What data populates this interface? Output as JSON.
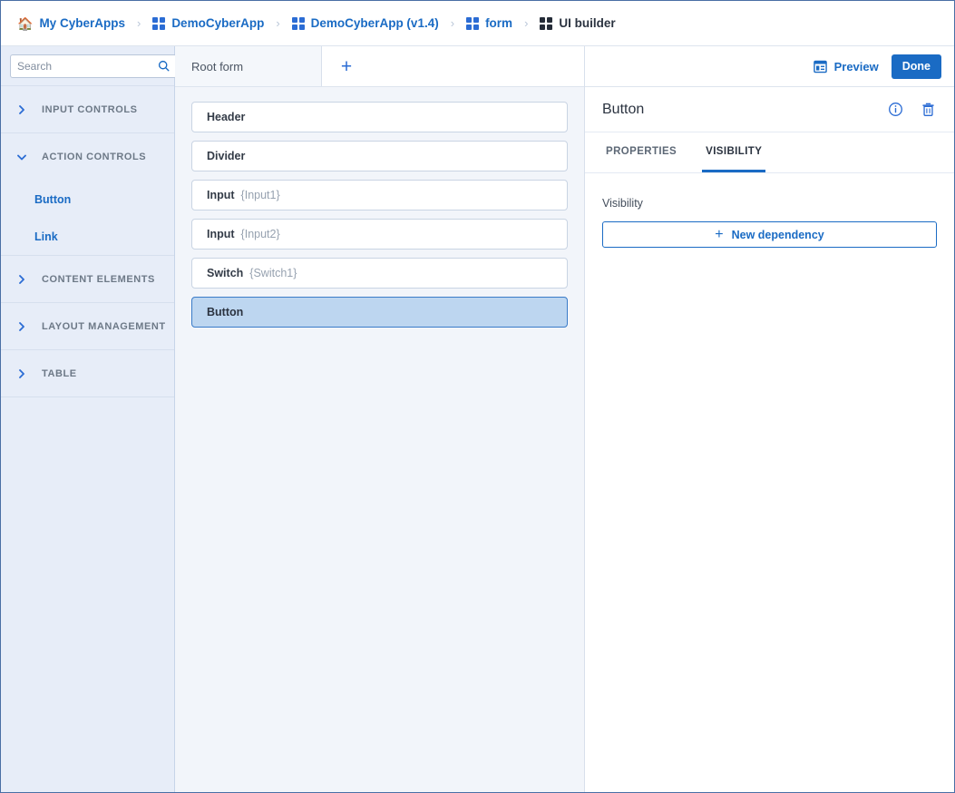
{
  "breadcrumb": {
    "items": [
      {
        "label": "My CyberApps",
        "icon": "home-icon",
        "current": false
      },
      {
        "label": "DemoCyberApp",
        "icon": "grid-icon",
        "current": false
      },
      {
        "label": "DemoCyberApp (v1.4)",
        "icon": "grid-icon",
        "current": false
      },
      {
        "label": "form",
        "icon": "grid-icon",
        "current": false
      },
      {
        "label": "UI builder",
        "icon": "grid-icon-dark",
        "current": true
      }
    ],
    "separator": "›"
  },
  "sidebar": {
    "search": {
      "placeholder": "Search",
      "value": "",
      "icon": "search-icon"
    },
    "categories": [
      {
        "label": "INPUT CONTROLS",
        "expanded": false,
        "children": []
      },
      {
        "label": "ACTION CONTROLS",
        "expanded": true,
        "children": [
          {
            "label": "Button"
          },
          {
            "label": "Link"
          }
        ]
      },
      {
        "label": "CONTENT ELEMENTS",
        "expanded": false,
        "children": []
      },
      {
        "label": "LAYOUT MANAGEMENT",
        "expanded": false,
        "children": []
      },
      {
        "label": "TABLE",
        "expanded": false,
        "children": []
      }
    ]
  },
  "canvas": {
    "tab_label": "Root form",
    "add_tab_label": "+",
    "widgets": [
      {
        "name": "Header",
        "ref": "",
        "selected": false
      },
      {
        "name": "Divider",
        "ref": "",
        "selected": false
      },
      {
        "name": "Input",
        "ref": "{Input1}",
        "selected": false
      },
      {
        "name": "Input",
        "ref": "{Input2}",
        "selected": false
      },
      {
        "name": "Switch",
        "ref": "{Switch1}",
        "selected": false
      },
      {
        "name": "Button",
        "ref": "",
        "selected": true
      }
    ]
  },
  "right_panel": {
    "preview_label": "Preview",
    "done_label": "Done",
    "title": "Button",
    "tabs": [
      {
        "label": "PROPERTIES",
        "active": false
      },
      {
        "label": "VISIBILITY",
        "active": true
      }
    ],
    "visibility": {
      "section_label": "Visibility",
      "new_dependency_label": "New dependency",
      "plus": "+"
    }
  },
  "colors": {
    "accent": "#1a6bc4",
    "selection_fill": "#bdd6f0",
    "sidebar_bg": "#e7edf8",
    "canvas_bg": "#f2f5fa",
    "frame_border": "#4a6fa5"
  }
}
